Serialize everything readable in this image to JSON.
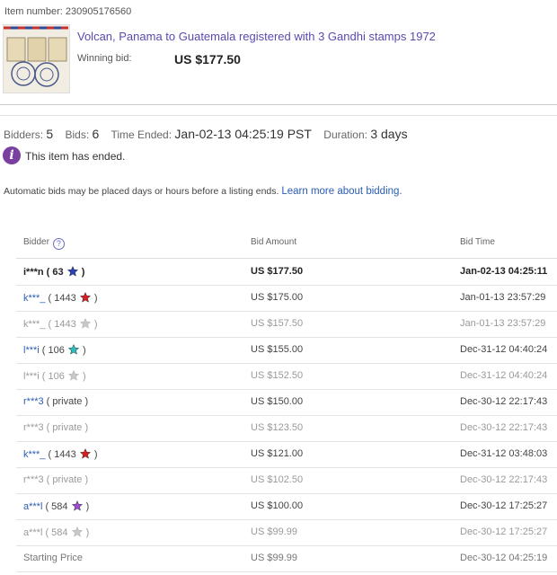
{
  "item": {
    "number_text": "Item number: 230905176560",
    "title": "Volcan, Panama to Guatemala registered with 3 Gandhi stamps 1972",
    "winning_bid_label": "Winning bid:",
    "winning_bid_value": "US $177.50"
  },
  "summary": {
    "bidders_label": "Bidders:",
    "bidders_value": "5",
    "bids_label": "Bids:",
    "bids_value": "6",
    "time_ended_label": "Time Ended:",
    "time_ended_value": "Jan-02-13 04:25:19 PST",
    "duration_label": "Duration:",
    "duration_value": "3 days"
  },
  "notice": {
    "icon": "info-icon",
    "text": "This item has ended."
  },
  "auto_note": {
    "text": "Automatic bids may be placed days or hours before a listing ends.",
    "link": "Learn more about bidding."
  },
  "table": {
    "headers": {
      "bidder": "Bidder",
      "amount": "Bid Amount",
      "time": "Bid Time"
    },
    "rows": [
      {
        "bidder": "i***n",
        "feedback": "( 63",
        "close": ")",
        "amount": "US $177.50",
        "time": "Jan-02-13 04:25:11",
        "style": "winner",
        "star": "#2a3fb5"
      },
      {
        "bidder": "k***_",
        "feedback": "( 1443",
        "close": ")",
        "amount": "US $175.00",
        "time": "Jan-01-13 23:57:29",
        "style": "active",
        "star": "#d42020"
      },
      {
        "bidder": "k***_",
        "feedback": "( 1443",
        "close": ")",
        "amount": "US $157.50",
        "time": "Jan-01-13 23:57:29",
        "style": "auto",
        "star": "#c8c8c8"
      },
      {
        "bidder": "l***i",
        "feedback": "( 106",
        "close": ")",
        "amount": "US $155.00",
        "time": "Dec-31-12 04:40:24",
        "style": "active",
        "star": "#2bbfbf"
      },
      {
        "bidder": "l***i",
        "feedback": "( 106",
        "close": ")",
        "amount": "US $152.50",
        "time": "Dec-31-12 04:40:24",
        "style": "auto",
        "star": "#c8c8c8"
      },
      {
        "bidder": "r***3",
        "feedback": "( private )",
        "close": "",
        "amount": "US $150.00",
        "time": "Dec-30-12 22:17:43",
        "style": "active",
        "star": ""
      },
      {
        "bidder": "r***3",
        "feedback": "( private )",
        "close": "",
        "amount": "US $123.50",
        "time": "Dec-30-12 22:17:43",
        "style": "auto",
        "star": ""
      },
      {
        "bidder": "k***_",
        "feedback": "( 1443",
        "close": ")",
        "amount": "US $121.00",
        "time": "Dec-31-12 03:48:03",
        "style": "active",
        "star": "#d42020"
      },
      {
        "bidder": "r***3",
        "feedback": "( private )",
        "close": "",
        "amount": "US $102.50",
        "time": "Dec-30-12 22:17:43",
        "style": "auto",
        "star": ""
      },
      {
        "bidder": "a***l",
        "feedback": "( 584",
        "close": ")",
        "amount": "US $100.00",
        "time": "Dec-30-12 17:25:27",
        "style": "active",
        "star": "#9b4fd0"
      },
      {
        "bidder": "a***l",
        "feedback": "( 584",
        "close": ")",
        "amount": "US $99.99",
        "time": "Dec-30-12 17:25:27",
        "style": "auto",
        "star": "#c8c8c8"
      },
      {
        "bidder": "Starting Price",
        "feedback": "",
        "close": "",
        "amount": "US $99.99",
        "time": "Dec-30-12 04:25:19",
        "style": "start",
        "star": ""
      }
    ]
  }
}
